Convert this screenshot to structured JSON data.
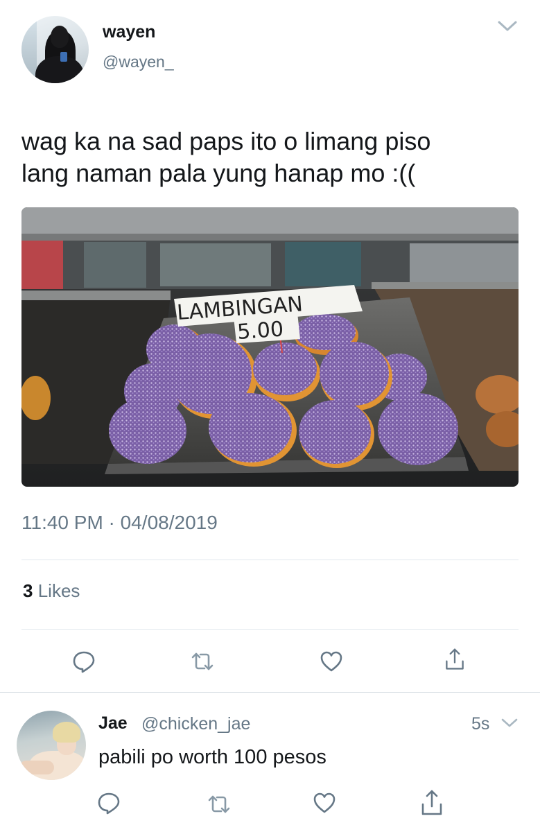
{
  "tweet": {
    "author_name": "wayen",
    "author_handle": "@wayen_",
    "text_line1": "wag ka na sad paps ito o limang piso",
    "text_line2": "lang naman pala yung hanap mo :((",
    "photo_sign_line1": "LAMBINGAN",
    "photo_sign_line2": "5.00",
    "timestamp": "11:40 PM · 04/08/2019",
    "likes_count": "3",
    "likes_label": "Likes"
  },
  "actions": {
    "reply": "reply-icon",
    "retweet": "retweet-icon",
    "like": "heart-icon",
    "share": "share-icon"
  },
  "reply": {
    "author_name": "Jae",
    "author_handle": "@chicken_jae",
    "time": "5s",
    "text": "pabili po worth 100 pesos"
  },
  "colors": {
    "text": "#14171a",
    "secondary": "#657786",
    "divider": "#e1e8ed"
  }
}
